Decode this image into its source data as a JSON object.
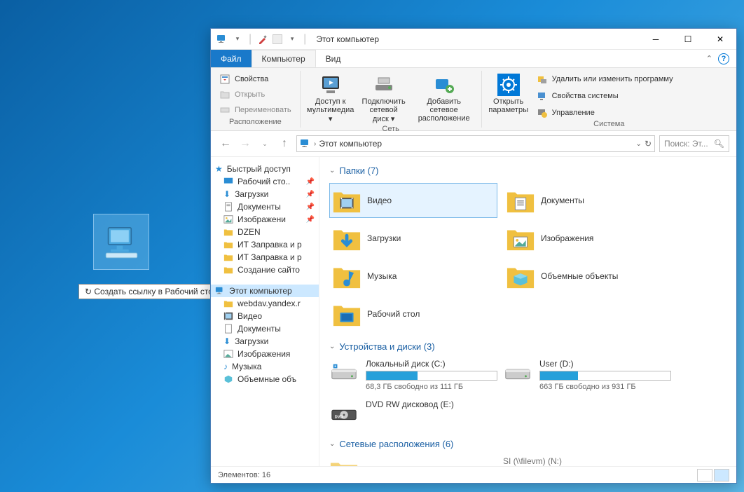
{
  "drag_tooltip": "↻ Создать ссылку в Рабочий стол",
  "titlebar": {
    "title": "Этот компьютер",
    "dropdown_chev": "▾"
  },
  "ribbon_tabs": {
    "file": "Файл",
    "computer": "Компьютер",
    "view": "Вид"
  },
  "ribbon": {
    "location": {
      "properties": "Свойства",
      "open": "Открыть",
      "rename": "Переименовать",
      "label": "Расположение"
    },
    "network": {
      "media": "Доступ к мультимедиа ▾",
      "map_drive": "Подключить сетевой диск ▾",
      "add_location": "Добавить сетевое расположение",
      "label": "Сеть"
    },
    "system": {
      "settings": "Открыть параметры",
      "programs": "Удалить или изменить программу",
      "sys_props": "Свойства системы",
      "manage": "Управление",
      "label": "Система"
    }
  },
  "address": {
    "segment": "Этот компьютер",
    "search_placeholder": "Поиск: Эт..."
  },
  "nav": {
    "quick": "Быстрый доступ",
    "desktop": "Рабочий сто..",
    "downloads": "Загрузки",
    "documents": "Документы",
    "pictures": "Изображени",
    "dzen": "DZEN",
    "it1": "ИТ Заправка и р",
    "it2": "ИТ Заправка и р",
    "site": "Создание сайто",
    "thispc": "Этот компьютер",
    "webdav": "webdav.yandex.r",
    "video": "Видео",
    "docs2": "Документы",
    "downloads2": "Загрузки",
    "pics2": "Изображения",
    "music": "Музыка",
    "volumes": "Объемные объ"
  },
  "sections": {
    "folders": "Папки (7)",
    "drives": "Устройства и диски (3)",
    "network": "Сетевые расположения (6)"
  },
  "folders": {
    "video": "Видео",
    "documents": "Документы",
    "downloads": "Загрузки",
    "pictures": "Изображения",
    "music": "Музыка",
    "objects3d": "Объемные объекты",
    "desktop": "Рабочий стол"
  },
  "drives": {
    "c": {
      "name": "Локальный диск (C:)",
      "free": "68,3 ГБ свободно из 111 ГБ",
      "fill_pct": 39
    },
    "d": {
      "name": "User (D:)",
      "free": "663 ГБ свободно из 931 ГБ",
      "fill_pct": 29
    },
    "dvd": {
      "name": "DVD RW дисковод (E:)"
    }
  },
  "net_loc": {
    "sl": "SI (\\\\filevm) (N:)"
  },
  "statusbar": {
    "count": "Элементов: 16"
  }
}
